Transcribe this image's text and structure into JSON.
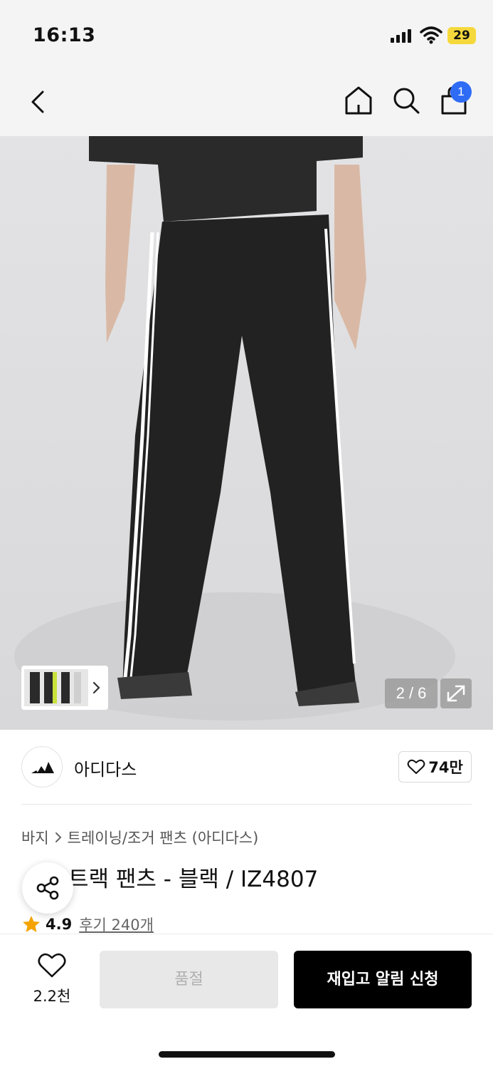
{
  "status_bar": {
    "time": "16:13",
    "battery": "29",
    "icons": [
      "signal-icon",
      "wifi-icon",
      "battery-icon"
    ]
  },
  "nav": {
    "icons": [
      "back-icon",
      "home-icon",
      "search-icon",
      "cart-icon"
    ],
    "cart_count": "1"
  },
  "gallery": {
    "counter": "2 / 6",
    "current": 2,
    "total": 6
  },
  "brand": {
    "name": "아디다스",
    "like_count": "74만"
  },
  "breadcrumb": {
    "items": [
      "바지",
      "트레이닝/조거 팬츠 (아디다스)"
    ]
  },
  "product": {
    "title": "트랙 팬츠 - 블랙 / IZ4807",
    "rating": "4.9",
    "reviews": "후기 240개"
  },
  "bottom_bar": {
    "wish_count": "2.2천",
    "soldout_label": "품절",
    "restock_label": "재입고 알림 신청"
  },
  "colors": {
    "accent_blue": "#2f6cf6",
    "star": "#f4a300",
    "battery": "#f5d93c",
    "primary_button": "#000000",
    "disabled_button": "#e8e8e8"
  }
}
